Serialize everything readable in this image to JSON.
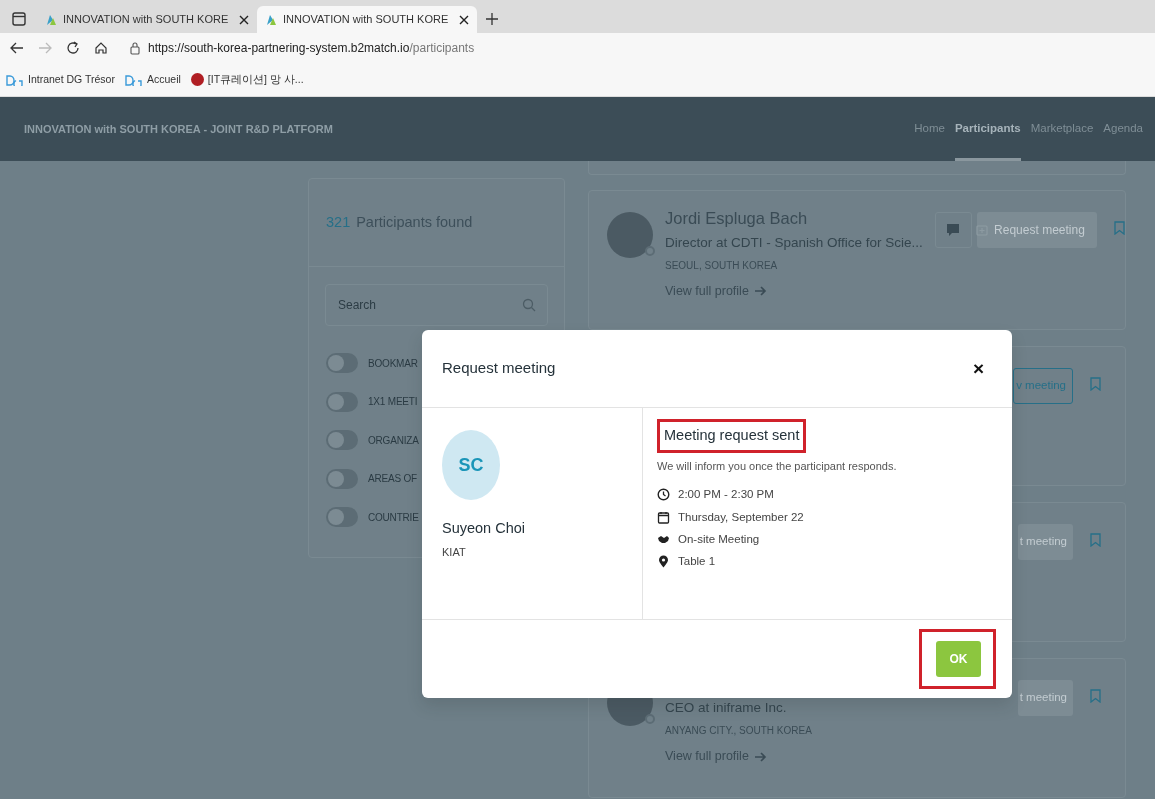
{
  "browser": {
    "tabs": [
      {
        "title": "INNOVATION with SOUTH KORE",
        "selected": false
      },
      {
        "title": "INNOVATION with SOUTH KORE",
        "selected": true
      }
    ],
    "url_host": "https://south-korea-partnering-system.b2match.io",
    "url_path": "/participants",
    "bookmarks": [
      {
        "kind": "dg",
        "label": "Intranet DG Trésor"
      },
      {
        "kind": "dg",
        "label": "Accueil"
      },
      {
        "kind": "badge",
        "label": "[IT큐레이션] 망 사..."
      }
    ]
  },
  "site": {
    "title": "INNOVATION with SOUTH KOREA - JOINT R&D PLATFORM",
    "nav": [
      {
        "label": "Home",
        "selected": false
      },
      {
        "label": "Participants",
        "selected": true
      },
      {
        "label": "Marketplace",
        "selected": false
      },
      {
        "label": "Agenda",
        "selected": false
      }
    ]
  },
  "filters": {
    "count": "321",
    "count_label": "Participants found",
    "search": {
      "placeholder": "Search"
    },
    "toggles": [
      {
        "label": "BOOKMAR",
        "on": false
      },
      {
        "label": "1X1 MEETI",
        "on": false
      },
      {
        "label": "ORGANIZA",
        "on": false
      },
      {
        "label": "AREAS OF",
        "on": false
      },
      {
        "label": "COUNTRIE",
        "on": false
      }
    ]
  },
  "participants": [
    {
      "kind": "full",
      "name": "Jordi Espluga Bach",
      "title": "Director at CDTI - Spanish Office for Scie...",
      "location": "SEOUL, SOUTH KOREA",
      "link": "View full profile",
      "button": "Request meeting",
      "button_disabled": true
    },
    {
      "kind": "covered",
      "button": "v meeting",
      "button_disabled": false
    },
    {
      "kind": "covered",
      "button": "t meeting",
      "button_disabled": true
    },
    {
      "kind": "lower",
      "title": "CEO at iniframe Inc.",
      "location": "ANYANG CITY., SOUTH KOREA",
      "link": "View full profile",
      "button": "t meeting",
      "button_disabled": true
    }
  ],
  "modal": {
    "title": "Request meeting",
    "close": "×",
    "participant": {
      "initials": "SC",
      "name": "Suyeon Choi",
      "organization": "KIAT"
    },
    "heading": "Meeting request sent",
    "heading_highlighted": true,
    "message": "We will inform you once the participant responds.",
    "details": [
      {
        "kind": "time",
        "text": "2:00 PM - 2:30 PM"
      },
      {
        "kind": "date",
        "text": "Thursday, September 22"
      },
      {
        "kind": "meeting",
        "text": "On-site Meeting"
      },
      {
        "kind": "location",
        "text": "Table 1"
      }
    ],
    "ok": {
      "label": "OK",
      "highlighted": true
    }
  }
}
